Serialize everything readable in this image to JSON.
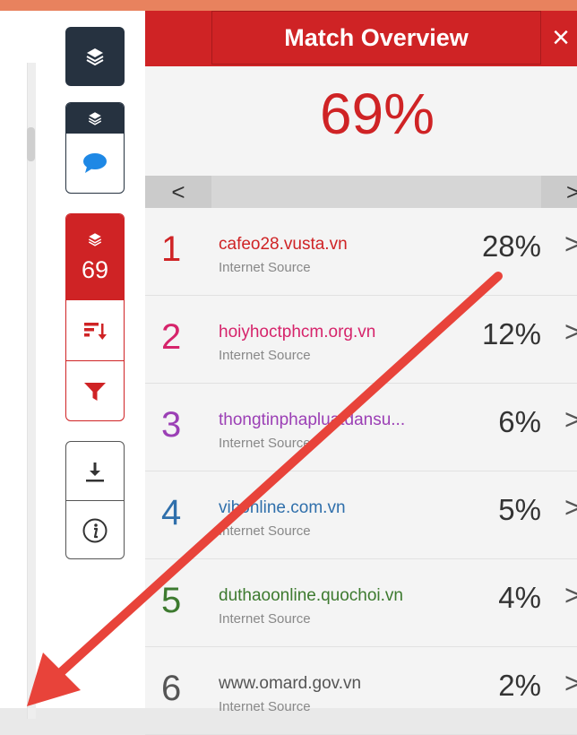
{
  "toolbar": {
    "match_count": "69"
  },
  "panel": {
    "title": "Match Overview",
    "close_glyph": "×",
    "overall_percent": "69%",
    "prev_glyph": "<",
    "next_glyph": ">"
  },
  "sources": [
    {
      "rank": "1",
      "name": "cafeo28.vusta.vn",
      "type": "Internet Source",
      "percent": "28%",
      "color": "#cf2325"
    },
    {
      "rank": "2",
      "name": "hoiyhoctphcm.org.vn",
      "type": "Internet Source",
      "percent": "12%",
      "color": "#d6246b"
    },
    {
      "rank": "3",
      "name": "thongtinphapluatdansu...",
      "type": "Internet Source",
      "percent": "6%",
      "color": "#9b3fb5"
    },
    {
      "rank": "4",
      "name": "vibonline.com.vn",
      "type": "Internet Source",
      "percent": "5%",
      "color": "#2f6fab"
    },
    {
      "rank": "5",
      "name": "duthaoonline.quochoi.vn",
      "type": "Internet Source",
      "percent": "4%",
      "color": "#3d7a2f"
    },
    {
      "rank": "6",
      "name": "www.omard.gov.vn",
      "type": "Internet Source",
      "percent": "2%",
      "color": "#555555"
    }
  ],
  "colors": {
    "brand_red": "#cf2325",
    "toolbar_dark": "#263240",
    "arrow": "#e8433a"
  },
  "icons": [
    "layers-icon",
    "comment-icon",
    "sort-icon",
    "filter-icon",
    "download-icon",
    "info-icon",
    "chevron-right-icon",
    "close-icon"
  ]
}
